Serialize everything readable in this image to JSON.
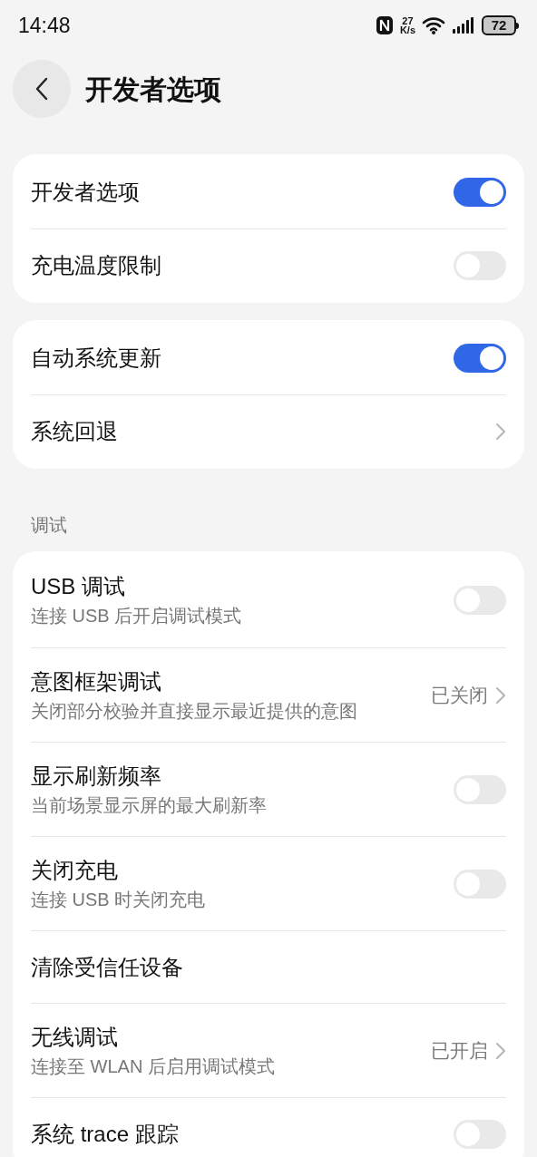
{
  "status_bar": {
    "time": "14:48",
    "speed_value": "27",
    "speed_unit": "K/s",
    "battery": "72"
  },
  "header": {
    "title": "开发者选项"
  },
  "groups": [
    {
      "rows": [
        {
          "kind": "toggle",
          "title": "开发者选项",
          "on": true
        },
        {
          "kind": "toggle",
          "title": "充电温度限制",
          "on": false
        }
      ]
    },
    {
      "rows": [
        {
          "kind": "toggle",
          "title": "自动系统更新",
          "on": true
        },
        {
          "kind": "link",
          "title": "系统回退"
        }
      ]
    },
    {
      "section": "调试",
      "rows": [
        {
          "kind": "toggle",
          "title": "USB 调试",
          "subtitle": "连接 USB 后开启调试模式",
          "on": false
        },
        {
          "kind": "link",
          "title": "意图框架调试",
          "subtitle": "关闭部分校验并直接显示最近提供的意图",
          "value": "已关闭"
        },
        {
          "kind": "toggle",
          "title": "显示刷新频率",
          "subtitle": "当前场景显示屏的最大刷新率",
          "on": false
        },
        {
          "kind": "toggle",
          "title": "关闭充电",
          "subtitle": "连接 USB 时关闭充电",
          "on": false
        },
        {
          "kind": "plain",
          "title": "清除受信任设备"
        },
        {
          "kind": "link",
          "title": "无线调试",
          "subtitle": "连接至 WLAN 后启用调试模式",
          "value": "已开启"
        },
        {
          "kind": "toggle",
          "title": "系统 trace 跟踪",
          "on": false
        }
      ]
    }
  ]
}
